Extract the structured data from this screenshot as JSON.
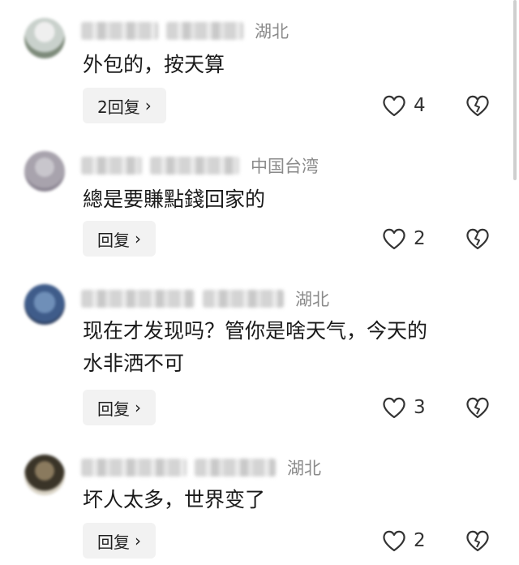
{
  "comments": [
    {
      "location": "湖北",
      "text": "外包的，按天算",
      "reply_label": "2回复",
      "like_count": "4",
      "avatar_colors": [
        "#c9d1cc",
        "#7d8a7a",
        "#efefef"
      ]
    },
    {
      "location": "中国台湾",
      "text": "總是要賺點錢回家的",
      "reply_label": "回复",
      "like_count": "2",
      "avatar_colors": [
        "#a8a3ad",
        "#c8c6cc",
        "#8b8592"
      ]
    },
    {
      "location": "湖北",
      "text_line1": "现在才发现吗？管你是啥天气，今天的",
      "text_line2": "水非洒不可",
      "reply_label": "回复",
      "like_count": "3",
      "avatar_colors": [
        "#3f5c8a",
        "#6f8fb8",
        "#2d3f60"
      ]
    },
    {
      "location": "湖北",
      "text": "坏人太多，世界变了",
      "reply_label": "回复",
      "like_count": "2",
      "avatar_colors": [
        "#3a3428",
        "#8a7a5e",
        "#d8d2c4"
      ]
    }
  ],
  "icons": {
    "like": "heart-outline",
    "dislike": "broken-heart-outline",
    "reply_chevron": "chevron-right",
    "chevron_glyph": "›"
  },
  "colors": {
    "location": "#8a8a8a",
    "reply_bg": "#f2f2f2",
    "icon_stroke": "#333333"
  }
}
